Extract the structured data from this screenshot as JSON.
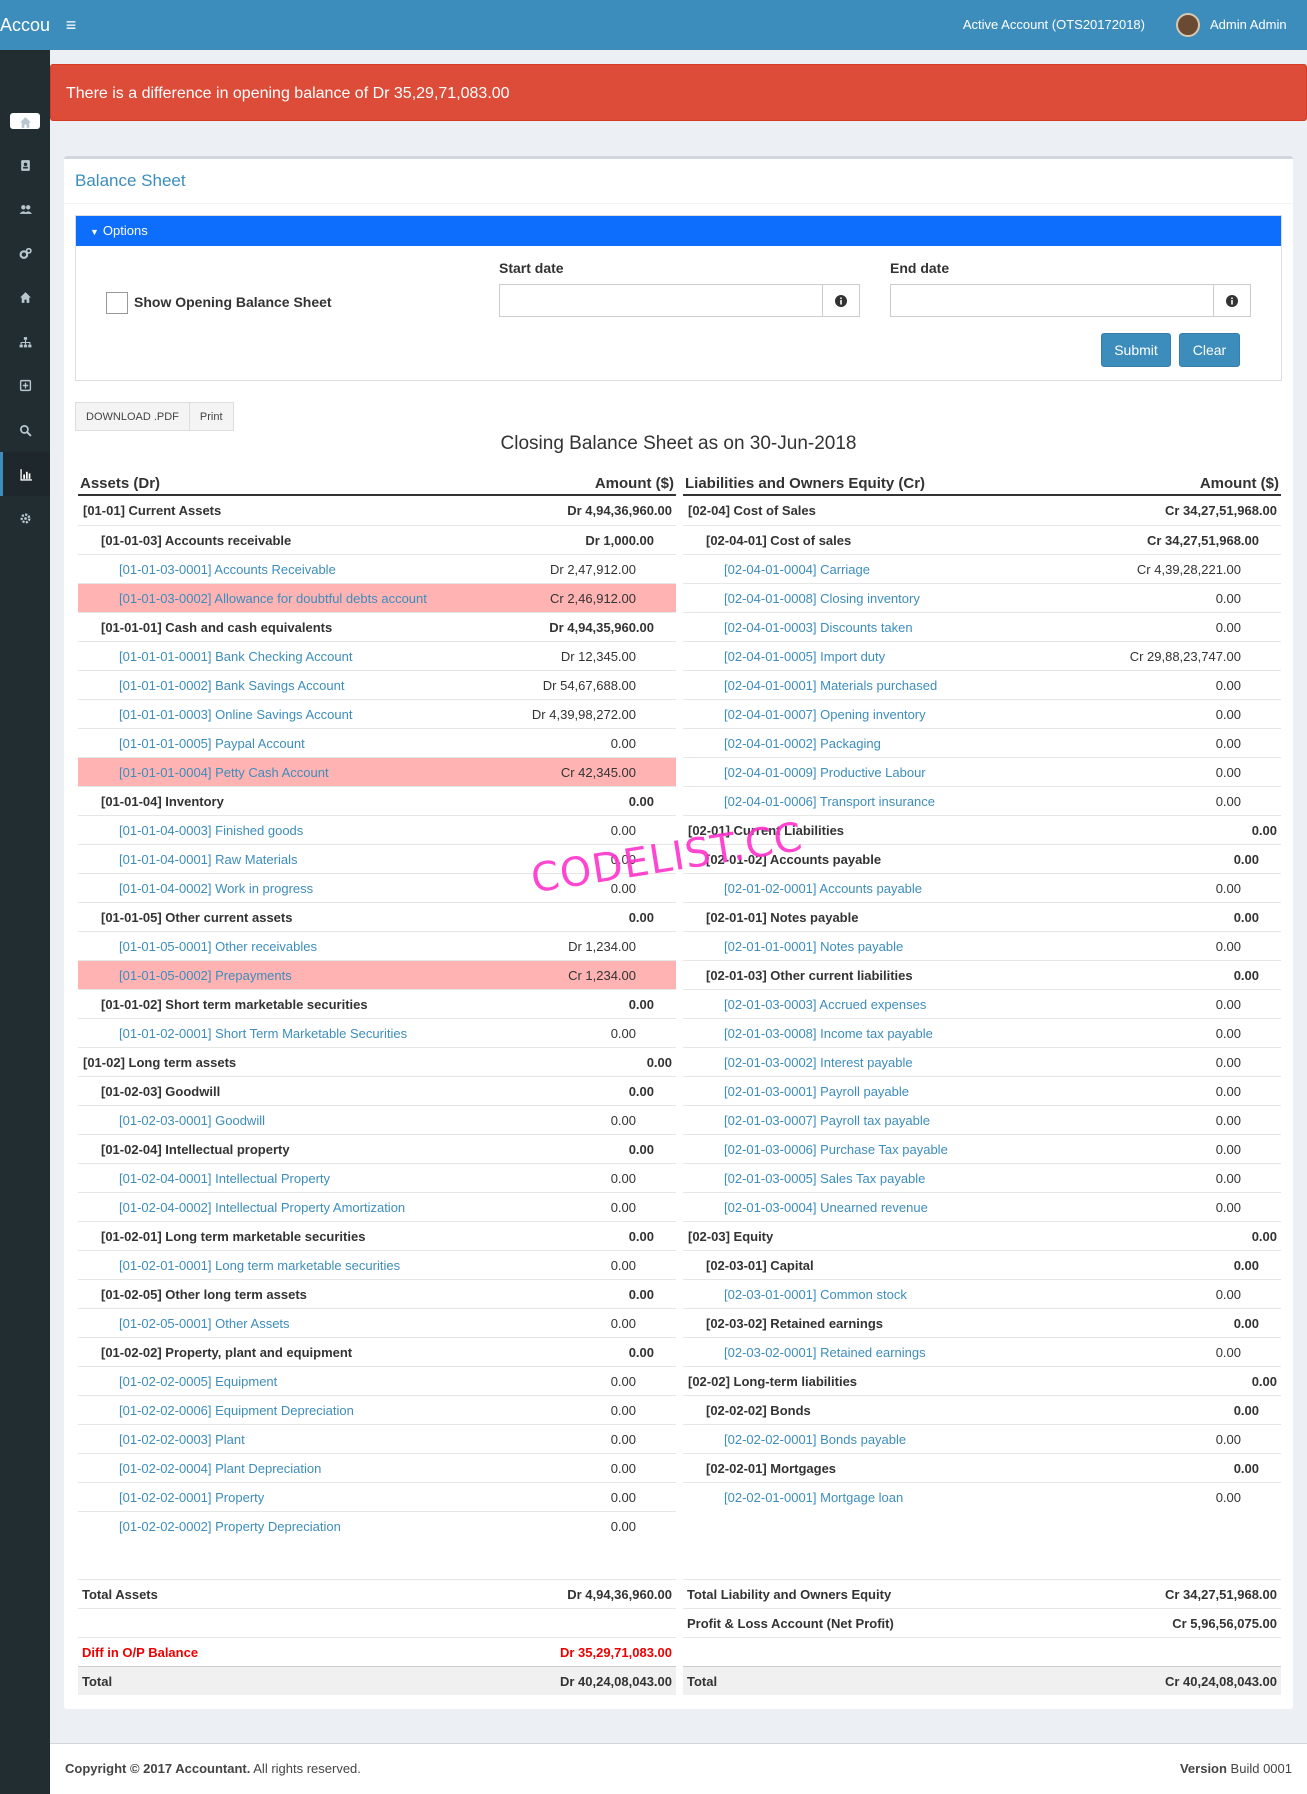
{
  "topbar": {
    "brand": "Accountant",
    "active_account": "Active Account (OTS20172018)",
    "user": "Admin Admin"
  },
  "sidebar": {
    "icons": [
      "home-icon",
      "contact-book-icon",
      "users-icon",
      "cogs-icon",
      "home-icon",
      "sitemap-icon",
      "plus-square-icon",
      "search-icon",
      "bar-chart-icon",
      "gear-icon"
    ],
    "active_index": 8
  },
  "alert": {
    "text": "There is a difference in opening balance of Dr 35,29,71,083.00"
  },
  "panel": {
    "title": "Balance Sheet"
  },
  "options": {
    "header": "Options",
    "show_opening_label": "Show Opening Balance Sheet",
    "start_date_label": "Start date",
    "end_date_label": "End date",
    "start_date_value": "",
    "end_date_value": "",
    "submit_label": "Submit",
    "clear_label": "Clear"
  },
  "actions": {
    "download_label": "DOWNLOAD .PDF",
    "print_label": "Print"
  },
  "sheet_title": "Closing Balance Sheet as on 30-Jun-2018",
  "assets": {
    "header_name": "Assets (Dr)",
    "header_amount": "Amount ($)",
    "rows": [
      {
        "level": 1,
        "name": "[01-01] Current Assets",
        "amount": "Dr 4,94,36,960.00"
      },
      {
        "level": 2,
        "name": "[01-01-03] Accounts receivable",
        "amount": "Dr 1,000.00"
      },
      {
        "level": 3,
        "name": "[01-01-03-0001] Accounts Receivable",
        "amount": "Dr 2,47,912.00"
      },
      {
        "level": 3,
        "name": "[01-01-03-0002] Allowance for doubtful debts account",
        "amount": "Cr 2,46,912.00",
        "highlight": true
      },
      {
        "level": 2,
        "name": "[01-01-01] Cash and cash equivalents",
        "amount": "Dr 4,94,35,960.00"
      },
      {
        "level": 3,
        "name": "[01-01-01-0001] Bank Checking Account",
        "amount": "Dr 12,345.00"
      },
      {
        "level": 3,
        "name": "[01-01-01-0002] Bank Savings Account",
        "amount": "Dr 54,67,688.00"
      },
      {
        "level": 3,
        "name": "[01-01-01-0003] Online Savings Account",
        "amount": "Dr 4,39,98,272.00"
      },
      {
        "level": 3,
        "name": "[01-01-01-0005] Paypal Account",
        "amount": "0.00"
      },
      {
        "level": 3,
        "name": "[01-01-01-0004] Petty Cash Account",
        "amount": "Cr 42,345.00",
        "highlight": true
      },
      {
        "level": 2,
        "name": "[01-01-04] Inventory",
        "amount": "0.00"
      },
      {
        "level": 3,
        "name": "[01-01-04-0003] Finished goods",
        "amount": "0.00"
      },
      {
        "level": 3,
        "name": "[01-01-04-0001] Raw Materials",
        "amount": "0.00"
      },
      {
        "level": 3,
        "name": "[01-01-04-0002] Work in progress",
        "amount": "0.00"
      },
      {
        "level": 2,
        "name": "[01-01-05] Other current assets",
        "amount": "0.00"
      },
      {
        "level": 3,
        "name": "[01-01-05-0001] Other receivables",
        "amount": "Dr 1,234.00"
      },
      {
        "level": 3,
        "name": "[01-01-05-0002] Prepayments",
        "amount": "Cr 1,234.00",
        "highlight": true
      },
      {
        "level": 2,
        "name": "[01-01-02] Short term marketable securities",
        "amount": "0.00"
      },
      {
        "level": 3,
        "name": "[01-01-02-0001] Short Term Marketable Securities",
        "amount": "0.00"
      },
      {
        "level": 1,
        "name": "[01-02] Long term assets",
        "amount": "0.00"
      },
      {
        "level": 2,
        "name": "[01-02-03] Goodwill",
        "amount": "0.00"
      },
      {
        "level": 3,
        "name": "[01-02-03-0001] Goodwill",
        "amount": "0.00"
      },
      {
        "level": 2,
        "name": "[01-02-04] Intellectual property",
        "amount": "0.00"
      },
      {
        "level": 3,
        "name": "[01-02-04-0001] Intellectual Property",
        "amount": "0.00"
      },
      {
        "level": 3,
        "name": "[01-02-04-0002] Intellectual Property Amortization",
        "amount": "0.00"
      },
      {
        "level": 2,
        "name": "[01-02-01] Long term marketable securities",
        "amount": "0.00"
      },
      {
        "level": 3,
        "name": "[01-02-01-0001] Long term marketable securities",
        "amount": "0.00"
      },
      {
        "level": 2,
        "name": "[01-02-05] Other long term assets",
        "amount": "0.00"
      },
      {
        "level": 3,
        "name": "[01-02-05-0001] Other Assets",
        "amount": "0.00"
      },
      {
        "level": 2,
        "name": "[01-02-02] Property, plant and equipment",
        "amount": "0.00"
      },
      {
        "level": 3,
        "name": "[01-02-02-0005] Equipment",
        "amount": "0.00"
      },
      {
        "level": 3,
        "name": "[01-02-02-0006] Equipment Depreciation",
        "amount": "0.00"
      },
      {
        "level": 3,
        "name": "[01-02-02-0003] Plant",
        "amount": "0.00"
      },
      {
        "level": 3,
        "name": "[01-02-02-0004] Plant Depreciation",
        "amount": "0.00"
      },
      {
        "level": 3,
        "name": "[01-02-02-0001] Property",
        "amount": "0.00"
      },
      {
        "level": 3,
        "name": "[01-02-02-0002] Property Depreciation",
        "amount": "0.00"
      }
    ]
  },
  "liabilities": {
    "header_name": "Liabilities and Owners Equity (Cr)",
    "header_amount": "Amount ($)",
    "rows": [
      {
        "level": 1,
        "name": "[02-04] Cost of Sales",
        "amount": "Cr 34,27,51,968.00"
      },
      {
        "level": 2,
        "name": "[02-04-01] Cost of sales",
        "amount": "Cr 34,27,51,968.00"
      },
      {
        "level": 3,
        "name": "[02-04-01-0004] Carriage",
        "amount": "Cr 4,39,28,221.00"
      },
      {
        "level": 3,
        "name": "[02-04-01-0008] Closing inventory",
        "amount": "0.00"
      },
      {
        "level": 3,
        "name": "[02-04-01-0003] Discounts taken",
        "amount": "0.00"
      },
      {
        "level": 3,
        "name": "[02-04-01-0005] Import duty",
        "amount": "Cr 29,88,23,747.00"
      },
      {
        "level": 3,
        "name": "[02-04-01-0001] Materials purchased",
        "amount": "0.00"
      },
      {
        "level": 3,
        "name": "[02-04-01-0007] Opening inventory",
        "amount": "0.00"
      },
      {
        "level": 3,
        "name": "[02-04-01-0002] Packaging",
        "amount": "0.00"
      },
      {
        "level": 3,
        "name": "[02-04-01-0009] Productive Labour",
        "amount": "0.00"
      },
      {
        "level": 3,
        "name": "[02-04-01-0006] Transport insurance",
        "amount": "0.00"
      },
      {
        "level": 1,
        "name": "[02-01] Current Liabilities",
        "amount": "0.00"
      },
      {
        "level": 2,
        "name": "[02-01-02] Accounts payable",
        "amount": "0.00"
      },
      {
        "level": 3,
        "name": "[02-01-02-0001] Accounts payable",
        "amount": "0.00"
      },
      {
        "level": 2,
        "name": "[02-01-01] Notes payable",
        "amount": "0.00"
      },
      {
        "level": 3,
        "name": "[02-01-01-0001] Notes payable",
        "amount": "0.00"
      },
      {
        "level": 2,
        "name": "[02-01-03] Other current liabilities",
        "amount": "0.00"
      },
      {
        "level": 3,
        "name": "[02-01-03-0003] Accrued expenses",
        "amount": "0.00"
      },
      {
        "level": 3,
        "name": "[02-01-03-0008] Income tax payable",
        "amount": "0.00"
      },
      {
        "level": 3,
        "name": "[02-01-03-0002] Interest payable",
        "amount": "0.00"
      },
      {
        "level": 3,
        "name": "[02-01-03-0001] Payroll payable",
        "amount": "0.00"
      },
      {
        "level": 3,
        "name": "[02-01-03-0007] Payroll tax payable",
        "amount": "0.00"
      },
      {
        "level": 3,
        "name": "[02-01-03-0006] Purchase Tax payable",
        "amount": "0.00"
      },
      {
        "level": 3,
        "name": "[02-01-03-0005] Sales Tax payable",
        "amount": "0.00"
      },
      {
        "level": 3,
        "name": "[02-01-03-0004] Unearned revenue",
        "amount": "0.00"
      },
      {
        "level": 1,
        "name": "[02-03] Equity",
        "amount": "0.00"
      },
      {
        "level": 2,
        "name": "[02-03-01] Capital",
        "amount": "0.00"
      },
      {
        "level": 3,
        "name": "[02-03-01-0001] Common stock",
        "amount": "0.00"
      },
      {
        "level": 2,
        "name": "[02-03-02] Retained earnings",
        "amount": "0.00"
      },
      {
        "level": 3,
        "name": "[02-03-02-0001] Retained earnings",
        "amount": "0.00"
      },
      {
        "level": 1,
        "name": "[02-02] Long-term liabilities",
        "amount": "0.00"
      },
      {
        "level": 2,
        "name": "[02-02-02] Bonds",
        "amount": "0.00"
      },
      {
        "level": 3,
        "name": "[02-02-02-0001] Bonds payable",
        "amount": "0.00"
      },
      {
        "level": 2,
        "name": "[02-02-01] Mortgages",
        "amount": "0.00"
      },
      {
        "level": 3,
        "name": "[02-02-01-0001] Mortgage loan",
        "amount": "0.00"
      }
    ]
  },
  "totals": {
    "left": [
      {
        "label": "Total Assets",
        "value": "Dr 4,94,36,960.00",
        "style": ""
      },
      {
        "label": "",
        "value": "",
        "style": "blank"
      },
      {
        "label": "Diff in O/P Balance",
        "value": "Dr 35,29,71,083.00",
        "style": "red"
      },
      {
        "label": "Total",
        "value": "Dr 40,24,08,043.00",
        "style": "grey"
      }
    ],
    "right": [
      {
        "label": "Total Liability and Owners Equity",
        "value": "Cr 34,27,51,968.00",
        "style": ""
      },
      {
        "label": "Profit & Loss Account (Net Profit)",
        "value": "Cr 5,96,56,075.00",
        "style": ""
      },
      {
        "label": "",
        "value": "",
        "style": "blank"
      },
      {
        "label": "Total",
        "value": "Cr 40,24,08,043.00",
        "style": "grey"
      }
    ]
  },
  "watermark": "CODELIST.CC",
  "footer": {
    "copyright": "Copyright © 2017 Accountant.",
    "rights": " All rights reserved.",
    "version_label": "Version",
    "version_value": " Build 0001"
  }
}
